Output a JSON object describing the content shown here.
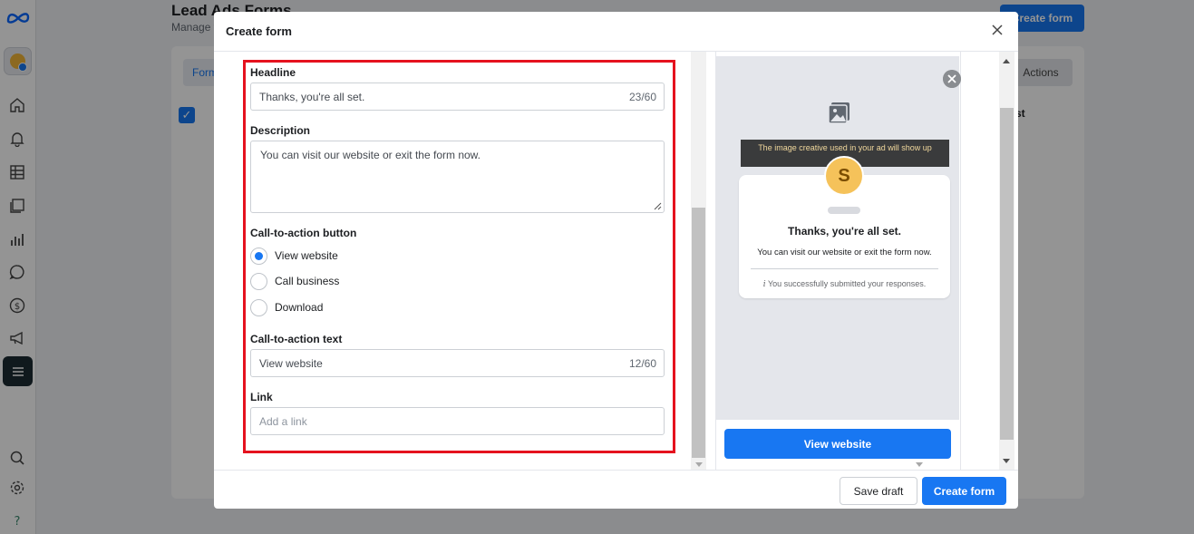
{
  "background": {
    "page_title": "Lead Ads Forms",
    "page_subtitle": "Manage f",
    "create_button": "Create form",
    "tab_label": "Form",
    "actions_button": "Actions",
    "row_text": "st"
  },
  "modal": {
    "title": "Create form",
    "headline": {
      "label": "Headline",
      "value": "Thanks, you're all set.",
      "count": "23/60"
    },
    "description": {
      "label": "Description",
      "value": "You can visit our website or exit the form now."
    },
    "cta": {
      "label": "Call-to-action button",
      "options": [
        {
          "label": "View website",
          "checked": true
        },
        {
          "label": "Call business",
          "checked": false
        },
        {
          "label": "Download",
          "checked": false
        }
      ]
    },
    "cta_text": {
      "label": "Call-to-action text",
      "value": "View website",
      "count": "12/60"
    },
    "link": {
      "label": "Link",
      "placeholder": "Add a link"
    },
    "footer": {
      "save_draft": "Save draft",
      "create_form": "Create form"
    }
  },
  "preview": {
    "creative_banner": "The image creative used in your ad will show up",
    "avatar_letter": "S",
    "headline": "Thanks, you're all set.",
    "description": "You can visit our website or exit the form now.",
    "note_icon": "i",
    "note": "You successfully submitted your responses.",
    "button": "View website"
  },
  "colors": {
    "accent": "#1877f2",
    "highlight_border": "#e5121e"
  }
}
